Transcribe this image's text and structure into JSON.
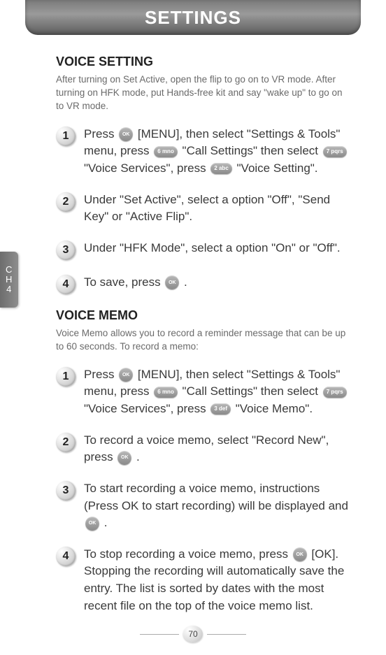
{
  "header": {
    "title": "SETTINGS"
  },
  "sideTab": {
    "line1": "C",
    "line2": "H",
    "line3": "4"
  },
  "pageNumber": "70",
  "keys": {
    "ok": "OK",
    "k2": "2 abc",
    "k3": "3 def",
    "k6": "6 mno",
    "k7": "7 pqrs"
  },
  "sections": [
    {
      "title": "VOICE SETTING",
      "desc": "After turning on Set Active, open the flip to go on to VR mode. After turning on HFK mode, put Hands-free kit and say \"wake up\" to go on to VR mode.",
      "steps": [
        {
          "num": "1",
          "parts": [
            {
              "t": "text",
              "v": "Press "
            },
            {
              "t": "key",
              "k": "ok"
            },
            {
              "t": "text",
              "v": " [MENU], then select \"Settings & Tools\" menu, press "
            },
            {
              "t": "key",
              "k": "k6"
            },
            {
              "t": "text",
              "v": " \"Call Settings\" then select "
            },
            {
              "t": "key",
              "k": "k7"
            },
            {
              "t": "text",
              "v": " \"Voice Services\", press "
            },
            {
              "t": "key",
              "k": "k2"
            },
            {
              "t": "text",
              "v": " \"Voice Setting\"."
            }
          ]
        },
        {
          "num": "2",
          "parts": [
            {
              "t": "text",
              "v": "Under \"Set Active\", select a option \"Off\", \"Send Key\" or \"Active Flip\"."
            }
          ]
        },
        {
          "num": "3",
          "parts": [
            {
              "t": "text",
              "v": "Under \"HFK Mode\", select a option \"On\" or \"Off\"."
            }
          ]
        },
        {
          "num": "4",
          "parts": [
            {
              "t": "text",
              "v": "To save, press "
            },
            {
              "t": "key",
              "k": "ok"
            },
            {
              "t": "text",
              "v": " ."
            }
          ]
        }
      ]
    },
    {
      "title": "VOICE MEMO",
      "desc": "Voice Memo allows you to record a reminder message that can be up to 60 seconds. To record a memo:",
      "steps": [
        {
          "num": "1",
          "parts": [
            {
              "t": "text",
              "v": "Press "
            },
            {
              "t": "key",
              "k": "ok"
            },
            {
              "t": "text",
              "v": " [MENU], then select \"Settings & Tools\" menu, press "
            },
            {
              "t": "key",
              "k": "k6"
            },
            {
              "t": "text",
              "v": " \"Call Settings\" then select "
            },
            {
              "t": "key",
              "k": "k7"
            },
            {
              "t": "text",
              "v": " \"Voice Services\", press "
            },
            {
              "t": "key",
              "k": "k3"
            },
            {
              "t": "text",
              "v": " \"Voice Memo\"."
            }
          ]
        },
        {
          "num": "2",
          "parts": [
            {
              "t": "text",
              "v": "To record a voice memo, select \"Record New\", press "
            },
            {
              "t": "key",
              "k": "ok"
            },
            {
              "t": "text",
              "v": " ."
            }
          ]
        },
        {
          "num": "3",
          "parts": [
            {
              "t": "text",
              "v": "To start recording a voice memo, instructions (Press OK to start recording) will be displayed and "
            },
            {
              "t": "key",
              "k": "ok"
            },
            {
              "t": "text",
              "v": " ."
            }
          ]
        },
        {
          "num": "4",
          "parts": [
            {
              "t": "text",
              "v": "To stop recording a voice memo, press "
            },
            {
              "t": "key",
              "k": "ok"
            },
            {
              "t": "text",
              "v": " [OK]. Stopping the recording will automatically save the entry. The list is sorted by dates with the most recent file on the top of the voice memo list."
            }
          ]
        }
      ]
    }
  ]
}
